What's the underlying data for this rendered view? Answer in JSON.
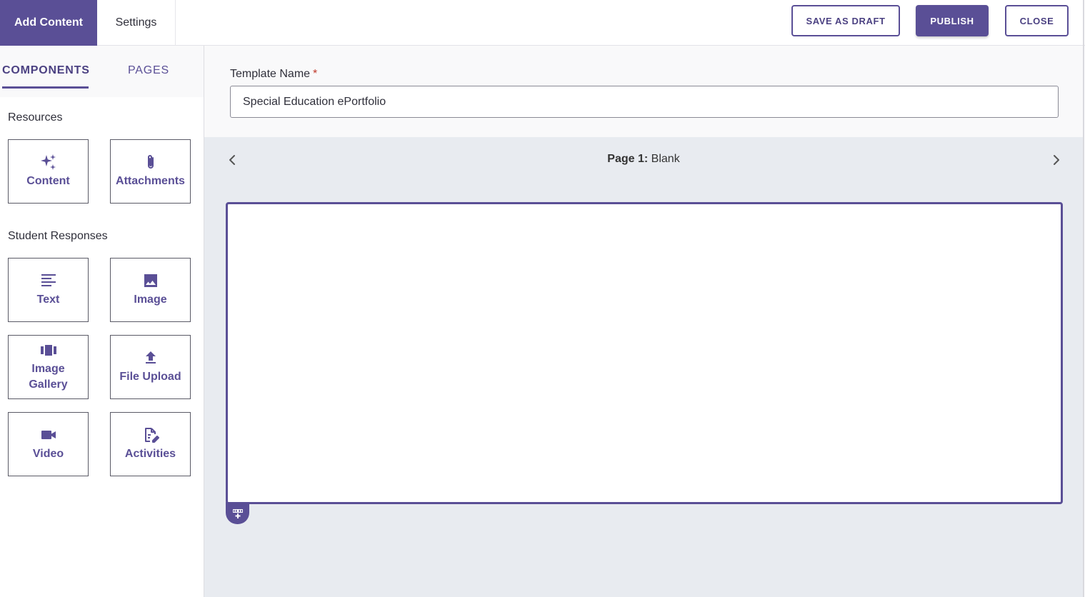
{
  "header": {
    "tabs": [
      {
        "label": "Add Content",
        "active": true
      },
      {
        "label": "Settings",
        "active": false
      }
    ],
    "buttons": {
      "save_draft": "SAVE AS DRAFT",
      "publish": "PUBLISH",
      "close": "CLOSE"
    }
  },
  "sidebar": {
    "tabs": [
      {
        "label": "COMPONENTS",
        "active": true
      },
      {
        "label": "PAGES",
        "active": false
      }
    ],
    "sections": [
      {
        "title": "Resources",
        "items": [
          {
            "label": "Content",
            "icon": "sparkle-icon"
          },
          {
            "label": "Attachments",
            "icon": "paperclip-icon"
          }
        ]
      },
      {
        "title": "Student Responses",
        "items": [
          {
            "label": "Text",
            "icon": "text-lines-icon"
          },
          {
            "label": "Image",
            "icon": "image-icon"
          },
          {
            "label": "Image Gallery",
            "icon": "gallery-icon"
          },
          {
            "label": "File Upload",
            "icon": "upload-icon"
          },
          {
            "label": "Video",
            "icon": "video-camera-icon"
          },
          {
            "label": "Activities",
            "icon": "edit-document-icon"
          }
        ]
      }
    ]
  },
  "main": {
    "template_name_label": "Template Name",
    "required_mark": "*",
    "template_name_value": "Special Education ePortfolio",
    "page_nav": {
      "page_prefix": "Page 1:",
      "page_name": "Blank"
    }
  },
  "colors": {
    "accent": "#5a4f96",
    "canvas_bg": "#e8ebf0",
    "required": "#c0392b"
  }
}
